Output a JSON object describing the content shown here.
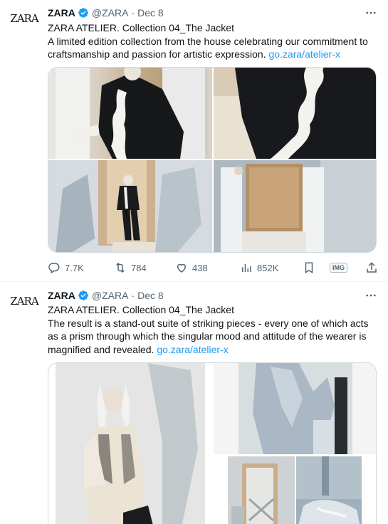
{
  "tweets": [
    {
      "author": {
        "name": "ZARA",
        "handle": "@ZARA",
        "date": "Dec 8",
        "avatar_text": "ZARA",
        "verified": true
      },
      "text_line1": "ZARA ATELIER. Collection 04_The Jacket",
      "text_body": "A limited edition collection from the house celebrating our commitment to craftsmanship and passion for artistic expression.",
      "link": "go.zara/atelier-x",
      "stats": {
        "replies": "7.7K",
        "retweets": "784",
        "likes": "438",
        "views": "852K",
        "img_badge": "IMG"
      }
    },
    {
      "author": {
        "name": "ZARA",
        "handle": "@ZARA",
        "date": "Dec 8",
        "avatar_text": "ZARA",
        "verified": true
      },
      "text_line1": "ZARA ATELIER. Collection 04_The Jacket",
      "text_body": "The result is a stand-out suite of striking pieces - every one of which acts as a prism through which the singular mood and attitude of the wearer is magnified and revealed.",
      "link": "go.zara/atelier-x"
    }
  ],
  "colors": {
    "accent": "#1d9bf0",
    "muted": "#536471",
    "text": "#0f1419",
    "border": "#cfd9de"
  },
  "icons": [
    "more-icon",
    "verified-badge-icon",
    "reply-icon",
    "retweet-icon",
    "like-icon",
    "views-icon",
    "bookmark-icon",
    "share-icon"
  ]
}
